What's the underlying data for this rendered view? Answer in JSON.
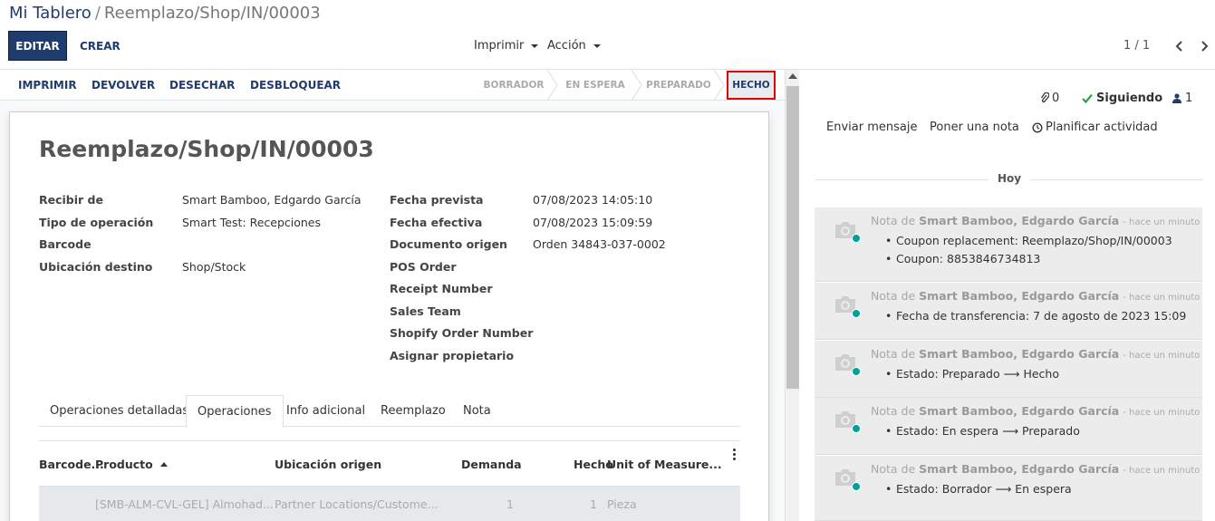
{
  "breadcrumb": {
    "root": "Mi Tablero",
    "separator": "/",
    "current": "Reemplazo/Shop/IN/00003"
  },
  "toolbar": {
    "edit": "EDITAR",
    "create": "CREAR",
    "print": "Imprimir",
    "action": "Acción"
  },
  "pager": {
    "value": "1 / 1",
    "prev": "‹",
    "next": "›"
  },
  "statusbar": {
    "buttons": [
      "IMPRIMIR",
      "DEVOLVER",
      "DESECHAR",
      "DESBLOQUEAR"
    ],
    "stages": [
      "BORRADOR",
      "EN ESPERA",
      "PREPARADO"
    ],
    "current_stage": "HECHO"
  },
  "form": {
    "title": "Reemplazo/Shop/IN/00003",
    "left_fields": [
      {
        "label": "Recibir de",
        "value": "Smart Bamboo, Edgardo García"
      },
      {
        "label": "Tipo de operación",
        "value": "Smart Test: Recepciones"
      },
      {
        "label": "Barcode",
        "value": ""
      },
      {
        "label": "Ubicación destino",
        "value": "Shop/Stock"
      }
    ],
    "right_fields": [
      {
        "label": "Fecha prevista",
        "value": "07/08/2023 14:05:10"
      },
      {
        "label": "Fecha efectiva",
        "value": "07/08/2023 15:09:59"
      },
      {
        "label": "Documento origen",
        "value": "Orden 34843-037-0002"
      },
      {
        "label": "POS Order",
        "value": ""
      },
      {
        "label": "Receipt Number",
        "value": ""
      },
      {
        "label": "Sales Team",
        "value": ""
      },
      {
        "label": "Shopify Order Number",
        "value": ""
      },
      {
        "label": "Asignar propietario",
        "value": ""
      }
    ],
    "tabs": [
      "Operaciones detalladas",
      "Operaciones",
      "Info adicional",
      "Reemplazo",
      "Nota"
    ],
    "active_tab": "Operaciones",
    "table": {
      "columns": [
        "Barcode...",
        "Producto",
        "Ubicación origen",
        "Demanda",
        "Hecho",
        "Unit of Measure..."
      ],
      "rows": [
        {
          "barcode": "",
          "product": "[SMB-ALM-CVL-GEL] Almohad...",
          "location": "Partner Locations/Custome...",
          "demand": "1",
          "done": "1",
          "uom": "Pieza"
        }
      ]
    }
  },
  "chatter": {
    "attachments": "0",
    "following": "Siguiendo",
    "followers": "1",
    "actions": [
      "Enviar mensaje",
      "Poner una nota",
      "Planificar actividad"
    ],
    "today": "Hoy",
    "messages": [
      {
        "prefix": "Nota de",
        "author": "Smart Bamboo, Edgardo García",
        "time": "- hace un minuto",
        "lines": [
          "Coupon replacement: Reemplazo/Shop/IN/00003",
          "Coupon: 8853846734813"
        ]
      },
      {
        "prefix": "Nota de",
        "author": "Smart Bamboo, Edgardo García",
        "time": "- hace un minuto",
        "lines": [
          "Fecha de transferencia: 7 de agosto de 2023 15:09"
        ]
      },
      {
        "prefix": "Nota de",
        "author": "Smart Bamboo, Edgardo García",
        "time": "- hace un minuto",
        "lines": [
          "Estado: Preparado ⟶ Hecho"
        ]
      },
      {
        "prefix": "Nota de",
        "author": "Smart Bamboo, Edgardo García",
        "time": "- hace un minuto",
        "lines": [
          "Estado: En espera ⟶ Preparado"
        ]
      },
      {
        "prefix": "Nota de",
        "author": "Smart Bamboo, Edgardo García",
        "time": "- hace un minuto",
        "lines": [
          "Estado: Borrador ⟶ En espera"
        ]
      }
    ]
  },
  "colors": {
    "primary": "#1f3c6e",
    "highlight": "#e00000",
    "online": "#00a09d",
    "following": "#28a745"
  }
}
